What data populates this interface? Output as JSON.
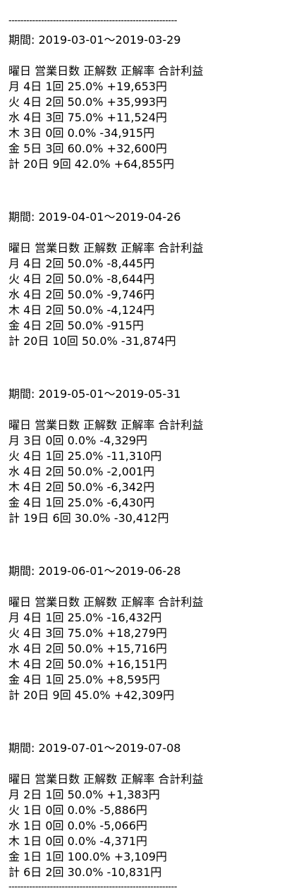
{
  "separator": "---------------------------------------------------------",
  "period_label": "期間:",
  "periods": [
    {
      "range": "2019-03-01～2019-03-29",
      "header": "曜日 営業日数 正解数 正解率 合計利益",
      "rows": [
        "月 4日 1回 25.0% +19,653円",
        "火 4日 2回 50.0% +35,993円",
        "水 4日 3回 75.0% +11,524円",
        "木 3日 0回 0.0% -34,915円",
        "金 5日 3回 60.0% +32,600円",
        "計 20日 9回 42.0% +64,855円"
      ]
    },
    {
      "range": "2019-04-01～2019-04-26",
      "header": "曜日 営業日数 正解数 正解率 合計利益",
      "rows": [
        "月 4日 2回 50.0% -8,445円",
        "火 4日 2回 50.0% -8,644円",
        "水 4日 2回 50.0% -9,746円",
        "木 4日 2回 50.0% -4,124円",
        "金 4日 2回 50.0% -915円",
        "計 20日 10回 50.0% -31,874円"
      ]
    },
    {
      "range": "2019-05-01～2019-05-31",
      "header": "曜日 営業日数 正解数 正解率 合計利益",
      "rows": [
        "月 3日 0回 0.0% -4,329円",
        "火 4日 1回 25.0% -11,310円",
        "水 4日 2回 50.0% -2,001円",
        "木 4日 2回 50.0% -6,342円",
        "金 4日 1回 25.0% -6,430円",
        "計 19日 6回 30.0% -30,412円"
      ]
    },
    {
      "range": "2019-06-01～2019-06-28",
      "header": "曜日 営業日数 正解数 正解率 合計利益",
      "rows": [
        "月 4日 1回 25.0% -16,432円",
        "火 4日 3回 75.0% +18,279円",
        "水 4日 2回 50.0% +15,716円",
        "木 4日 2回 50.0% +16,151円",
        "金 4日 1回 25.0% +8,595円",
        "計 20日 9回 45.0% +42,309円"
      ]
    },
    {
      "range": "2019-07-01～2019-07-08",
      "header": "曜日 営業日数 正解数 正解率 合計利益",
      "rows": [
        "月 2日 1回 50.0% +1,383円",
        "火 1日 0回 0.0% -5,886円",
        "水 1日 0回 0.0% -5,066円",
        "木 1日 0回 0.0% -4,371円",
        "金 1日 1回 100.0% +3,109円",
        "計 6日 2回 30.0% -10,831円"
      ]
    }
  ]
}
